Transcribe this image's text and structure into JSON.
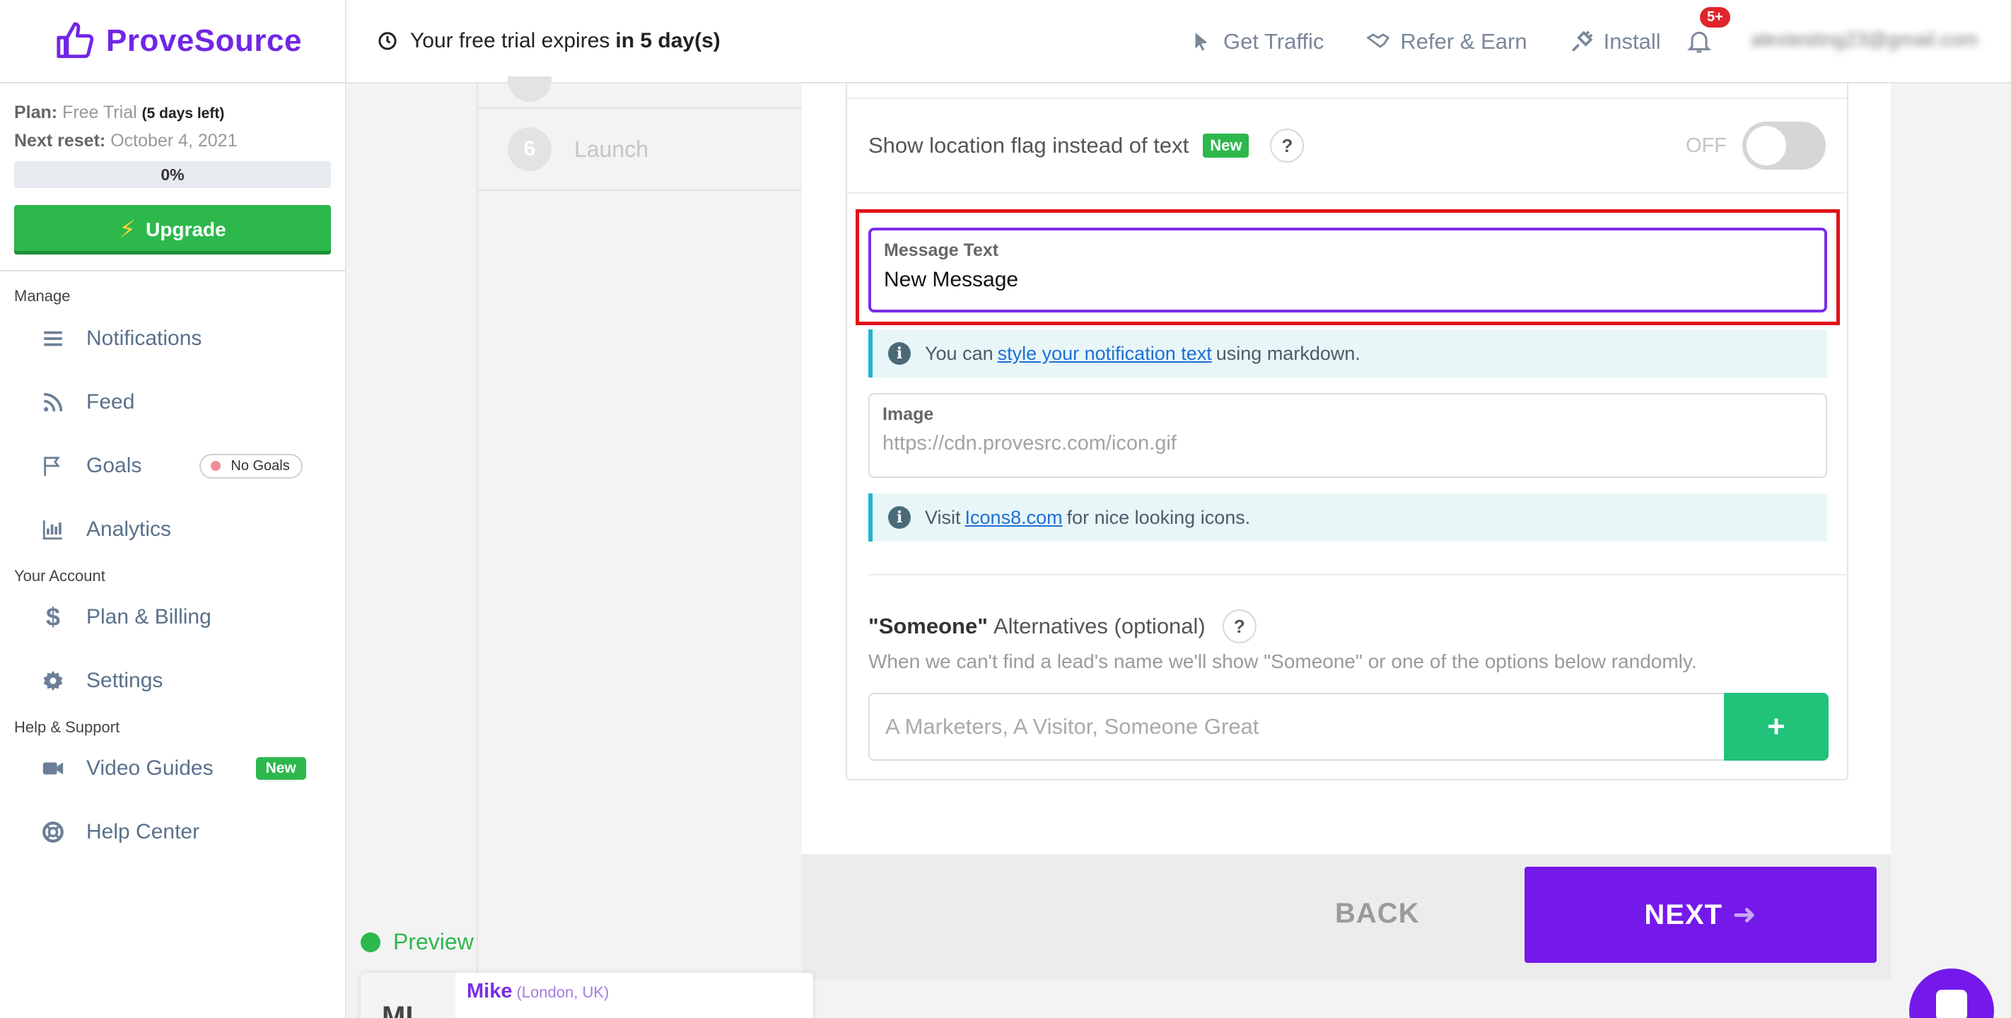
{
  "brand": {
    "name": "ProveSource",
    "color": "#7126e6"
  },
  "plan": {
    "plan_label": "Plan:",
    "plan_value": "Free Trial",
    "days_left": "(5 days left)",
    "reset_label": "Next reset:",
    "reset_value": "October 4, 2021",
    "progress": "0%",
    "upgrade_label": "Upgrade"
  },
  "sidebar": {
    "manage_label": "Manage",
    "manage_items": [
      {
        "label": "Notifications",
        "icon": "list-icon"
      },
      {
        "label": "Feed",
        "icon": "rss-icon"
      },
      {
        "label": "Goals",
        "icon": "flag-icon",
        "badge": "No Goals"
      },
      {
        "label": "Analytics",
        "icon": "bar-chart-icon"
      }
    ],
    "account_label": "Your Account",
    "account_items": [
      {
        "label": "Plan & Billing",
        "icon": "dollar-icon"
      },
      {
        "label": "Settings",
        "icon": "gear-icon"
      }
    ],
    "help_label": "Help & Support",
    "help_items": [
      {
        "label": "Video Guides",
        "icon": "video-icon",
        "badge": "New"
      },
      {
        "label": "Help Center",
        "icon": "lifebuoy-icon"
      }
    ]
  },
  "topbar": {
    "trial_text": "Your free trial expires",
    "trial_bold": "in 5 day(s)",
    "links": [
      "Get Traffic",
      "Refer & Earn",
      "Install"
    ],
    "notif_count": "5+",
    "email": "alextesting23@gmail.com"
  },
  "steps": {
    "items": [
      {
        "num": "6",
        "label": "Launch"
      }
    ]
  },
  "form": {
    "location_flag_label": "Show location flag instead of text",
    "location_flag_badge": "New",
    "help_mark": "?",
    "toggle_state": "OFF",
    "message_label": "Message Text",
    "message_value": "New Message",
    "info1": {
      "pre": "You can",
      "link": "style your notification text",
      "post": "using markdown."
    },
    "image_label": "Image",
    "image_placeholder": "https://cdn.provesrc.com/icon.gif",
    "info2": {
      "pre": "Visit",
      "link": "Icons8.com",
      "post": "for nice looking icons."
    },
    "someone_bold": "\"Someone\"",
    "someone_rest": "Alternatives (optional)",
    "someone_desc": "When we can't find a lead's name we'll show \"Someone\" or one of the options below randomly.",
    "alt_placeholder": "A Marketers, A Visitor, Someone Great",
    "plus": "+"
  },
  "footer": {
    "back": "BACK",
    "next": "NEXT"
  },
  "preview": {
    "label": "Preview",
    "avatar_text": "ML",
    "name": "Mike",
    "location": "(London, UK)"
  },
  "colors": {
    "accent": "#7519ea",
    "green": "#2db84c",
    "highlight": "#e0101a"
  }
}
